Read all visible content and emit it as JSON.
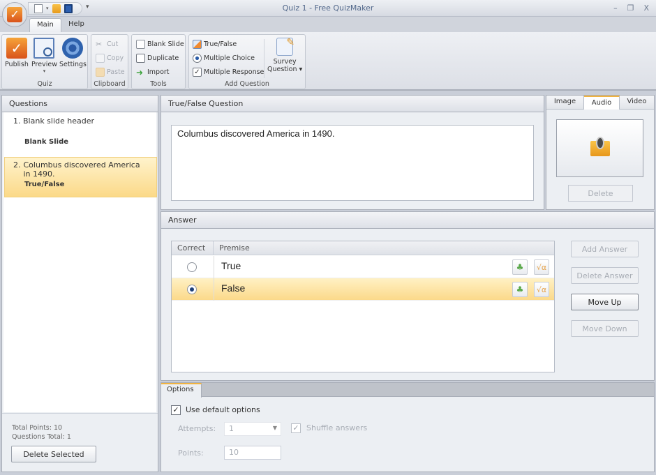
{
  "window": {
    "title": "Quiz 1 - Free QuizMaker",
    "controls": {
      "minimize": "–",
      "restore": "❐",
      "close": "X"
    }
  },
  "ribbon": {
    "tabs": [
      {
        "label": "Main",
        "active": true
      },
      {
        "label": "Help",
        "active": false
      }
    ],
    "groups": {
      "quiz": {
        "label": "Quiz",
        "buttons": [
          {
            "label": "Publish",
            "icon": "publish-icon"
          },
          {
            "label": "Preview",
            "icon": "preview-icon"
          },
          {
            "label": "Settings",
            "icon": "settings-icon"
          }
        ]
      },
      "clipboard": {
        "label": "Clipboard",
        "buttons": [
          {
            "label": "Cut",
            "icon": "cut-icon",
            "enabled": false
          },
          {
            "label": "Copy",
            "icon": "copy-icon",
            "enabled": false
          },
          {
            "label": "Paste",
            "icon": "paste-icon",
            "enabled": false
          }
        ]
      },
      "tools": {
        "label": "Tools",
        "buttons": [
          {
            "label": "Blank Slide",
            "icon": "blank-slide-icon"
          },
          {
            "label": "Duplicate",
            "icon": "duplicate-icon"
          },
          {
            "label": "Import",
            "icon": "import-icon"
          }
        ]
      },
      "add_question": {
        "label": "Add Question",
        "buttons": [
          {
            "label": "True/False",
            "icon": "true-false-icon"
          },
          {
            "label": "Multiple Choice",
            "icon": "multiple-choice-icon"
          },
          {
            "label": "Multiple Response",
            "icon": "multiple-response-icon"
          }
        ],
        "survey": {
          "line1": "Survey",
          "line2": "Question ▾"
        }
      }
    },
    "preview_arrow": "▾"
  },
  "questions": {
    "header": "Questions",
    "items": [
      {
        "number": "1.",
        "title": "Blank slide header",
        "type": "Blank Slide",
        "selected": false
      },
      {
        "number": "2.",
        "title": "Columbus discovered America in 1490.",
        "type": "True/False",
        "selected": true
      }
    ],
    "total_points": "Total Points: 10",
    "questions_total": "Questions Total: 1",
    "delete_button": "Delete Selected"
  },
  "question": {
    "header": "True/False Question",
    "text": "Columbus discovered America in 1490."
  },
  "media": {
    "tabs": [
      {
        "label": "Image",
        "active": false
      },
      {
        "label": "Audio",
        "active": true
      },
      {
        "label": "Video",
        "active": false
      }
    ],
    "delete_button": "Delete"
  },
  "answer": {
    "header": "Answer",
    "columns": [
      "Correct",
      "Premise"
    ],
    "rows": [
      {
        "premise": "True",
        "correct": false
      },
      {
        "premise": "False",
        "correct": true
      }
    ],
    "buttons": {
      "add": "Add Answer",
      "delete": "Delete Answer",
      "move_up": "Move Up",
      "move_down": "Move Down"
    }
  },
  "options": {
    "tab": "Options",
    "use_default": {
      "label": "Use default options",
      "checked": true
    },
    "attempts": {
      "label": "Attempts:",
      "value": "1"
    },
    "shuffle": {
      "label": "Shuffle answers",
      "checked": true
    },
    "points": {
      "label": "Points:",
      "value": "10"
    }
  },
  "colors": {
    "selection": "#fbd988",
    "accent": "#f0b340",
    "title_text": "#51678a"
  }
}
